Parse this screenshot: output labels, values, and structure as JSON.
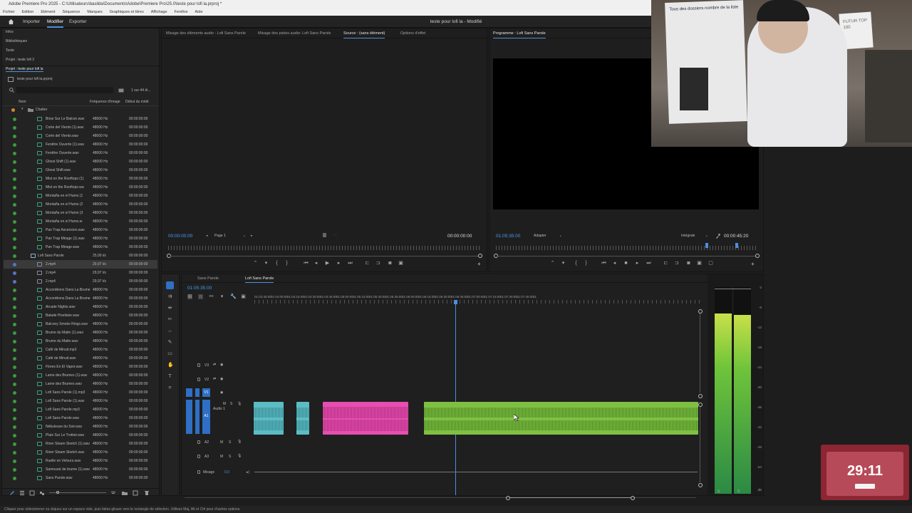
{
  "titlebar": {
    "text": "Adobe Premiere Pro 2025 - C:\\Utilisateurs\\basilda\\Documents\\Adobe\\Premiere Pro\\25.0\\teste pour lofi la.prproj *"
  },
  "menubar": {
    "items": [
      "Fichier",
      "Edition",
      "Elément",
      "Séquence",
      "Marques",
      "Graphiques et titres",
      "Affichage",
      "Fenêtre",
      "Aide"
    ]
  },
  "workspace": {
    "home_icon": "home-icon",
    "tabs": [
      "Importer",
      "Modifier",
      "Exporter"
    ],
    "active_tab": "Modifier",
    "doc_title": "teste pour lofi la - Modifié"
  },
  "left_panel": {
    "items": [
      "Infos",
      "Bibliothèques",
      "Texte",
      "Projet : teste lofi 2"
    ],
    "project_tab": "Projet : teste pour lofi la",
    "project_file": "teste pour lofi la.prproj",
    "count": "1 sur 44 él...",
    "columns": [
      "Nom",
      "Fréquence d'image",
      "Début du médi"
    ],
    "folder": "Chatter",
    "rows": [
      {
        "name": "Brise Sur Le Balcon.wav",
        "hz": "48000  Hz",
        "tc": "00:00:00:00",
        "color": "#3c9a3c",
        "type": "audio"
      },
      {
        "name": "Corte del Viento (1).wav",
        "hz": "48000  Hz",
        "tc": "00:00:00:00",
        "color": "#3c9a3c",
        "type": "audio"
      },
      {
        "name": "Corte del Viento.wav",
        "hz": "48000  Hz",
        "tc": "00:00:00:00",
        "color": "#3c9a3c",
        "type": "audio"
      },
      {
        "name": "Fenêtre Ouverte (1).wav",
        "hz": "48000  Hz",
        "tc": "00:00:00:00",
        "color": "#3c9a3c",
        "type": "audio"
      },
      {
        "name": "Fenêtre Ouverte.wav",
        "hz": "48000  Hz",
        "tc": "00:00:00:00",
        "color": "#3c9a3c",
        "type": "audio"
      },
      {
        "name": "Ghost Shift (1).wav",
        "hz": "48000  Hz",
        "tc": "00:00:00:00",
        "color": "#3c9a3c",
        "type": "audio"
      },
      {
        "name": "Ghost Shift.wav",
        "hz": "48000  Hz",
        "tc": "00:00:00:00",
        "color": "#3c9a3c",
        "type": "audio"
      },
      {
        "name": "Mist on the Rooftops (1)",
        "hz": "48000  Hz",
        "tc": "00:00:00:00",
        "color": "#3c9a3c",
        "type": "audio"
      },
      {
        "name": "Mist on the Rooftops.wa",
        "hz": "48000  Hz",
        "tc": "00:00:00:00",
        "color": "#3c9a3c",
        "type": "audio"
      },
      {
        "name": "Montaña en el Humo (1",
        "hz": "48000  Hz",
        "tc": "00:00:00:00",
        "color": "#3c9a3c",
        "type": "audio"
      },
      {
        "name": "Montaña en el Humo (2",
        "hz": "48000  Hz",
        "tc": "00:00:00:00",
        "color": "#3c9a3c",
        "type": "audio"
      },
      {
        "name": "Montaña en el Humo (3",
        "hz": "48000  Hz",
        "tc": "00:00:00:00",
        "color": "#3c9a3c",
        "type": "audio"
      },
      {
        "name": "Montaña en el Humo.w",
        "hz": "48000  Hz",
        "tc": "00:00:00:00",
        "color": "#3c9a3c",
        "type": "audio"
      },
      {
        "name": "Pan Trap Ascension.wav",
        "hz": "48000  Hz",
        "tc": "00:00:00:00",
        "color": "#3c9a3c",
        "type": "audio"
      },
      {
        "name": "Pan Trap Mirage (1).wav",
        "hz": "48000  Hz",
        "tc": "00:00:00:00",
        "color": "#3c9a3c",
        "type": "audio"
      },
      {
        "name": "Pan Trap Mirage.wav",
        "hz": "48000  Hz",
        "tc": "00:00:00:00",
        "color": "#3c9a3c",
        "type": "audio"
      },
      {
        "name": "Lofi Sans Parole",
        "hz": "25,00 i/s",
        "tc": "00:00:00:00",
        "color": "#3c9a3c",
        "type": "seq"
      },
      {
        "name": "2.mp4",
        "hz": "29,97 i/s",
        "tc": "00:00:00:00",
        "color": "#5a72c8",
        "type": "video",
        "selected": true
      },
      {
        "name": "2.mp4",
        "hz": "29,97 i/s",
        "tc": "00:00:00:00",
        "color": "#5a72c8",
        "type": "video"
      },
      {
        "name": "2.mp4",
        "hz": "29,97 i/s",
        "tc": "00:00:00:00",
        "color": "#5a72c8",
        "type": "video"
      },
      {
        "name": "Accordéons Dans La Brume (",
        "hz": "48000  Hz",
        "tc": "00:00:00:00",
        "color": "#3c9a3c",
        "type": "audio"
      },
      {
        "name": "Accordéons Dans La Brume",
        "hz": "48000  Hz",
        "tc": "00:00:00:00",
        "color": "#3c9a3c",
        "type": "audio"
      },
      {
        "name": "Arcade Nights.wav",
        "hz": "48000  Hz",
        "tc": "00:00:00:00",
        "color": "#3c9a3c",
        "type": "audio"
      },
      {
        "name": "Balade Pixelisée.wav",
        "hz": "48000  Hz",
        "tc": "00:00:00:00",
        "color": "#3c9a3c",
        "type": "audio"
      },
      {
        "name": "Balcony Smoke Rings.wav",
        "hz": "48000  Hz",
        "tc": "00:00:00:00",
        "color": "#3c9a3c",
        "type": "audio"
      },
      {
        "name": "Brume du Matin (1).wav",
        "hz": "48000  Hz",
        "tc": "00:00:00:00",
        "color": "#3c9a3c",
        "type": "audio"
      },
      {
        "name": "Brume du Matin.wav",
        "hz": "48000  Hz",
        "tc": "00:00:00:00",
        "color": "#3c9a3c",
        "type": "audio"
      },
      {
        "name": "Café de Minuit.mp3",
        "hz": "48000  Hz",
        "tc": "00:00:00:00",
        "color": "#3c9a3c",
        "type": "audio"
      },
      {
        "name": "Café de Minuit.wav",
        "hz": "48000  Hz",
        "tc": "00:00:00:00",
        "color": "#3c9a3c",
        "type": "audio"
      },
      {
        "name": "Flores En El Vapor.wav",
        "hz": "48000  Hz",
        "tc": "00:00:00:00",
        "color": "#3c9a3c",
        "type": "audio"
      },
      {
        "name": "Lame des Brumes (1).wav",
        "hz": "48000  Hz",
        "tc": "00:00:00:00",
        "color": "#3c9a3c",
        "type": "audio"
      },
      {
        "name": "Lame des Brumes.wav",
        "hz": "48000  Hz",
        "tc": "00:00:00:00",
        "color": "#3c9a3c",
        "type": "audio"
      },
      {
        "name": "Lofi Sans Parole (1).mp3",
        "hz": "48000  Hz",
        "tc": "00:00:00:00",
        "color": "#3c9a3c",
        "type": "audio"
      },
      {
        "name": "Lofi Sans Parole (1).wav",
        "hz": "48000  Hz",
        "tc": "00:00:00:00",
        "color": "#3c9a3c",
        "type": "audio"
      },
      {
        "name": "Lofi Sans Parole.mp3",
        "hz": "48000  Hz",
        "tc": "00:00:00:00",
        "color": "#3c9a3c",
        "type": "audio"
      },
      {
        "name": "Lofi Sans Parole.wav",
        "hz": "48000  Hz",
        "tc": "00:00:00:00",
        "color": "#3c9a3c",
        "type": "audio"
      },
      {
        "name": "Nébuleuse du Soir.wav",
        "hz": "48000  Hz",
        "tc": "00:00:00:00",
        "color": "#3c9a3c",
        "type": "audio"
      },
      {
        "name": "Pluie Sur Le Trottoir.wav",
        "hz": "48000  Hz",
        "tc": "00:00:00:00",
        "color": "#3c9a3c",
        "type": "audio"
      },
      {
        "name": "River Steam Sketch (1).wav",
        "hz": "48000  Hz",
        "tc": "00:00:00:00",
        "color": "#3c9a3c",
        "type": "audio"
      },
      {
        "name": "River Steam Sketch.wav",
        "hz": "48000  Hz",
        "tc": "00:00:00:00",
        "color": "#3c9a3c",
        "type": "audio"
      },
      {
        "name": "Ruelle en Velours.wav",
        "hz": "48000  Hz",
        "tc": "00:00:00:00",
        "color": "#3c9a3c",
        "type": "audio"
      },
      {
        "name": "Samouraï de brume (1).wav",
        "hz": "48000  Hz",
        "tc": "00:00:00:00",
        "color": "#3c9a3c",
        "type": "audio"
      },
      {
        "name": "Sans Parole.wav",
        "hz": "48000  Hz",
        "tc": "00:00:00:00",
        "color": "#3c9a3c",
        "type": "audio"
      }
    ]
  },
  "source_panel": {
    "tabs": [
      "Mixage des éléments audio : Lofi Sans Parole",
      "Mixage des pistes audio: Lofi Sans Parole",
      "Source : (sans élément)",
      "Options d'effet"
    ],
    "active_tab": "Source : (sans élément)",
    "tc_left": "00:00:00:00",
    "page_select": "Page 1",
    "tc_right": "00:00:00:00"
  },
  "program_panel": {
    "tab": "Programme : Lofi Sans Parole",
    "tc_left": "01:05:35:00",
    "fit_select": "Adapter",
    "quality_select": "Intégrale",
    "tc_right": "00:00:45:20"
  },
  "timeline": {
    "tabs": [
      "Sans Parole",
      "Lofi Sans Parole"
    ],
    "active_tab": "Lofi Sans Parole",
    "timecode": "01:05:35:00",
    "ruler": [
      "01:03:45:00",
      "01:04:00:00",
      "01:04:15:00",
      "01:04:30:00",
      "01:04:45:00",
      "01:05:00:00",
      "01:05:15:00",
      "01:05:30:00",
      "01:05:45:00",
      "01:06:00:00",
      "01:06:15:00",
      "01:06:30:00",
      "01:06:45:00",
      "01:07:00:00",
      "01:07:15:00",
      "01:07:30:00",
      "01:07:45:00",
      "01"
    ],
    "tracks": [
      "V3",
      "V2",
      "V1",
      "A1",
      "A2",
      "A3"
    ],
    "a1_name": "Audio 1",
    "mix_label": "Mixage",
    "mix_value": "0,0",
    "clip_colors": {
      "teal": "#5bbcc4",
      "pink": "#e64fb0",
      "green": "#7fc043"
    }
  },
  "meter": {
    "scale": [
      "0",
      "-6",
      "-12",
      "-18",
      "-24",
      "-30",
      "-36",
      "-42",
      "-48",
      "-54",
      "dB"
    ]
  },
  "status_bar": {
    "text": "Cliquez pour sélectionner ou cliquez sur un espace vide, puis faites glisser vers le rectangle de sélection. Utilisez Maj, Alt et Ctrl pour d'autres options."
  },
  "webcam": {
    "whiteboard_text": "Tous des dossiers nombre de la liste",
    "sign_text": "FUTUR TOP 100"
  },
  "timer_overlay": {
    "time": "29:11"
  }
}
